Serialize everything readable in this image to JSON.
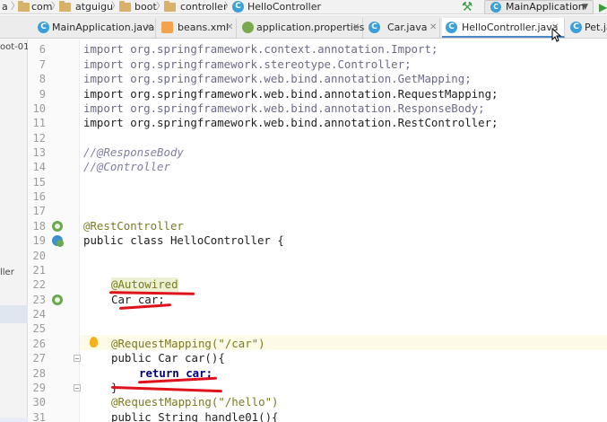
{
  "breadcrumb": {
    "items": [
      {
        "label": "a",
        "icon": "folder-icon"
      },
      {
        "label": "com",
        "icon": "folder-icon"
      },
      {
        "label": "atguigu",
        "icon": "folder-icon"
      },
      {
        "label": "boot",
        "icon": "folder-icon"
      },
      {
        "label": "controller",
        "icon": "folder-icon"
      },
      {
        "label": "HelloController",
        "icon": "class-icon"
      }
    ]
  },
  "run": {
    "config_label": "MainApplication",
    "config_icon": "class-icon",
    "build_icon": "hammer-icon",
    "run_icon": "play-icon"
  },
  "tabs": [
    {
      "label": "MainApplication.java",
      "icon": "class-icon",
      "active": false
    },
    {
      "label": "beans.xml",
      "icon": "xml-icon",
      "active": false
    },
    {
      "label": "application.properties",
      "icon": "properties-icon",
      "active": false
    },
    {
      "label": "Car.java",
      "icon": "class-icon",
      "active": false
    },
    {
      "label": "HelloController.java",
      "icon": "class-icon",
      "active": true
    },
    {
      "label": "Pet.ja",
      "icon": "class-icon",
      "active": false
    }
  ],
  "project": {
    "label_top": "oot-01",
    "label_mid": "ller"
  },
  "editor": {
    "class_icon_letter": "C",
    "lines": [
      {
        "num": "6",
        "text": "import org.springframework.context.annotation.Import;"
      },
      {
        "num": "7",
        "text": "import org.springframework.stereotype.Controller;"
      },
      {
        "num": "8",
        "text": "import org.springframework.web.bind.annotation.GetMapping;"
      },
      {
        "num": "9",
        "text": "import org.springframework.web.bind.annotation.RequestMapping;"
      },
      {
        "num": "10",
        "text": "import org.springframework.web.bind.annotation.ResponseBody;"
      },
      {
        "num": "11",
        "text": "import org.springframework.web.bind.annotation.RestController;"
      },
      {
        "num": "12",
        "text": ""
      },
      {
        "num": "13",
        "text": "//@ResponseBody"
      },
      {
        "num": "14",
        "text": "//@Controller"
      },
      {
        "num": "15",
        "text": ""
      },
      {
        "num": "16",
        "text": ""
      },
      {
        "num": "17",
        "text": ""
      },
      {
        "num": "18",
        "text": "@RestController"
      },
      {
        "num": "19",
        "text": "public class HelloController {"
      },
      {
        "num": "20",
        "text": ""
      },
      {
        "num": "21",
        "text": ""
      },
      {
        "num": "22",
        "text": "@Autowired"
      },
      {
        "num": "23",
        "text": "Car car;"
      },
      {
        "num": "24",
        "text": ""
      },
      {
        "num": "25",
        "text": ""
      },
      {
        "num": "26",
        "text": "@RequestMapping(\"/car\")"
      },
      {
        "num": "27",
        "text": "public Car car(){"
      },
      {
        "num": "28",
        "text": "return car;"
      },
      {
        "num": "29",
        "text": "}"
      },
      {
        "num": "30",
        "text": "@RequestMapping(\"/hello\")"
      },
      {
        "num": "31",
        "text": "public String handle01(){"
      }
    ]
  },
  "colors": {
    "keyword": "#00007f",
    "annotation": "#7a7a22",
    "string": "#067d17",
    "field": "#871094",
    "comment": "#7f7f9f",
    "annotation_underline": "#e0121b",
    "active_tab_accent": "#4a88c7"
  }
}
